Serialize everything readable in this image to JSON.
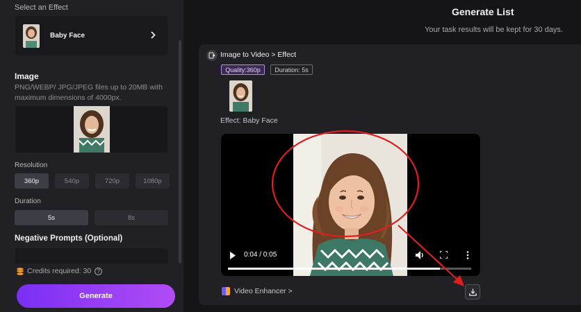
{
  "left_panel": {
    "select_effect_label": "Select an Effect",
    "effect": {
      "name": "Baby Face"
    },
    "image": {
      "heading": "Image",
      "description": "PNG/WEBP/ JPG/JPEG files up to 20MB with maximum dimensions of 4000px."
    },
    "resolution": {
      "label": "Resolution",
      "options": [
        "360p",
        "540p",
        "720p",
        "1080p"
      ],
      "selected": "360p"
    },
    "duration": {
      "label": "Duration",
      "options": [
        "5s",
        "8s"
      ],
      "selected": "5s"
    },
    "negative_prompts_label": "Negative Prompts (Optional)",
    "credits_label": "Credits required: 30",
    "help_glyph": "?",
    "generate_label": "Generate"
  },
  "generate_list": {
    "title": "Generate List",
    "subtitle": "Your task results will be kept for 30 days."
  },
  "task": {
    "title": "Image to Video > Effect",
    "quality_tag": "Quality:360p",
    "duration_tag": "Duration: 5s",
    "effect_line": "Effect: Baby Face",
    "player": {
      "time": "0:04 / 0:05",
      "progress": 0.87
    },
    "enhancer_label": "Video Enhancer >"
  },
  "icons": {
    "chevron": "chevron-right-icon",
    "play": "play-icon",
    "volume": "volume-icon",
    "fullscreen": "fullscreen-icon",
    "more": "more-vertical-icon",
    "download": "download-icon",
    "coin": "coins-icon"
  },
  "colors": {
    "accent_start": "#7a2ff5",
    "accent_end": "#b14cf5",
    "annotation_red": "#e01e1e"
  }
}
